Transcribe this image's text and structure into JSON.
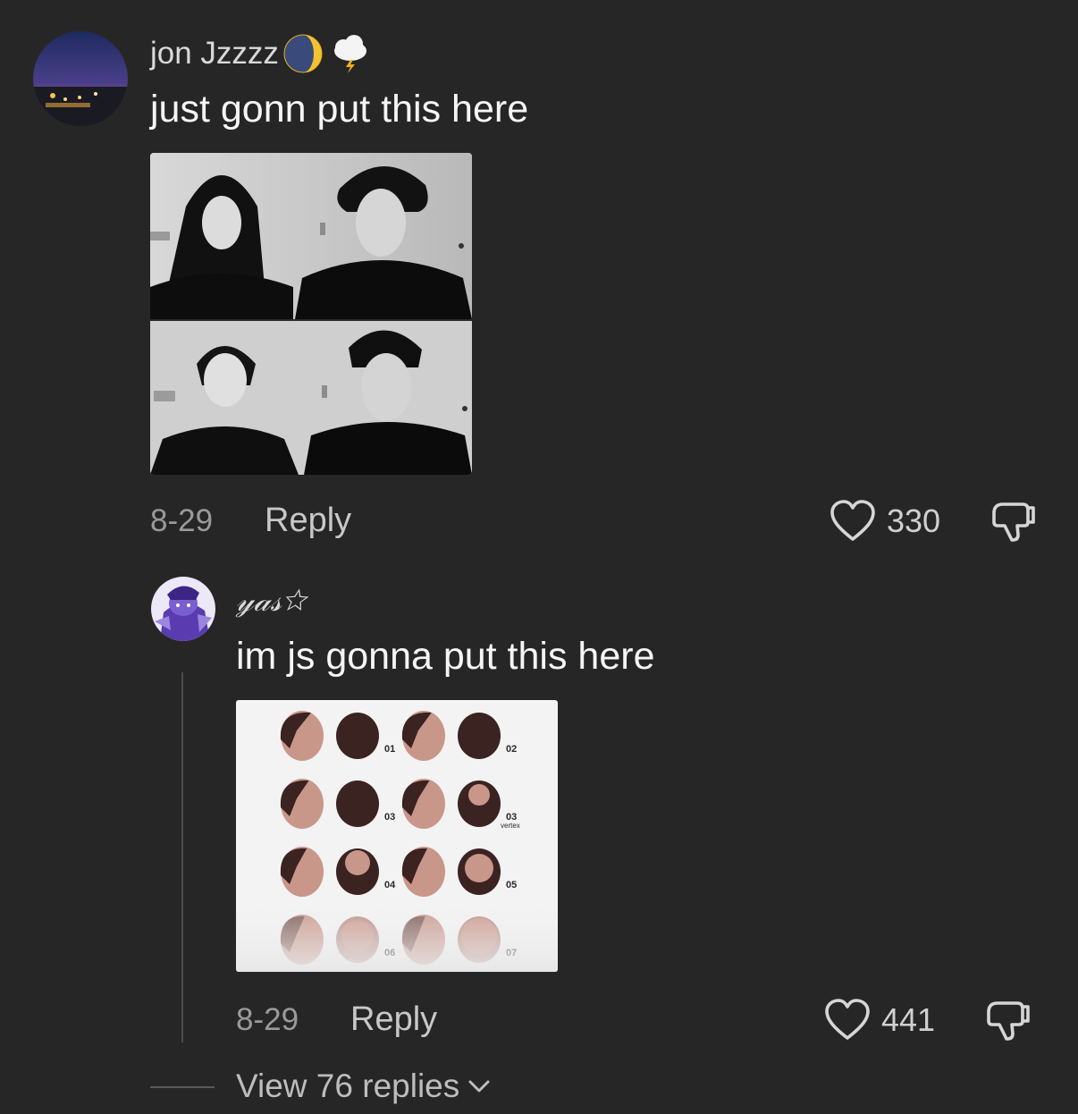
{
  "comments": [
    {
      "username": "jon Jzzzz",
      "text": "just gonn put this here",
      "date": "8-29",
      "reply_label": "Reply",
      "likes": "330"
    },
    {
      "username": "𝓎𝒶𝓈☆",
      "text": "im js gonna put this here",
      "date": "8-29",
      "reply_label": "Reply",
      "likes": "441",
      "chart_labels": [
        "01",
        "02",
        "03",
        "03",
        "04",
        "05",
        "06",
        "07"
      ],
      "chart_sublabel": "vertex"
    }
  ],
  "view_replies": "View 76 replies",
  "colors": {
    "background": "#262626",
    "accent_moon": "#f2c230"
  },
  "icons": [
    "moon-emoji-icon",
    "cloud-lightning-emoji-icon",
    "heart-icon",
    "dislike-icon",
    "chevron-down-icon"
  ]
}
